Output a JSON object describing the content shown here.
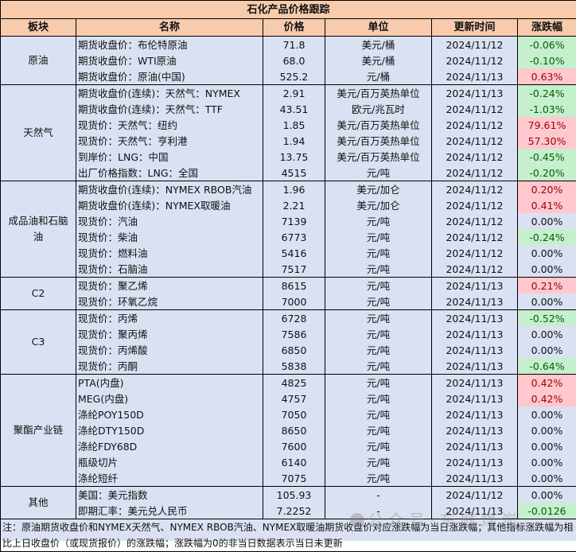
{
  "title": "石化产品价格跟踪",
  "headers": {
    "category": "板块",
    "name": "名称",
    "price": "价格",
    "unit": "单位",
    "date": "更新时间",
    "change": "涨跌幅"
  },
  "colors": {
    "header_bg": "#f8cbad",
    "body_bg": "#dae1f2",
    "up_bg": "#ffc7ce",
    "up_text": "#9c0006",
    "down_bg": "#c6efce",
    "down_text": "#006100"
  },
  "groups": [
    {
      "category": "原油",
      "rows": [
        {
          "name": "期货收盘价：布伦特原油",
          "price": "71.8",
          "unit": "美元/桶",
          "date": "2024/11/12",
          "change": "-0.06%",
          "trend": "down"
        },
        {
          "name": "期货收盘价：WTI原油",
          "price": "68.0",
          "unit": "美元/桶",
          "date": "2024/11/12",
          "change": "-0.10%",
          "trend": "down"
        },
        {
          "name": "期货收盘价：原油(中国)",
          "price": "525.2",
          "unit": "元/桶",
          "date": "2024/11/13",
          "change": "0.63%",
          "trend": "up"
        }
      ]
    },
    {
      "category": "天然气",
      "rows": [
        {
          "name": "期货收盘价(连续)：天然气：NYMEX",
          "price": "2.91",
          "unit": "美元/百万英热单位",
          "date": "2024/11/13",
          "change": "-0.24%",
          "trend": "down"
        },
        {
          "name": "期货收盘价(连续)：天然气：TTF",
          "price": "43.51",
          "unit": "欧元/兆瓦时",
          "date": "2024/11/12",
          "change": "-1.03%",
          "trend": "down"
        },
        {
          "name": "现货价：天然气：纽约",
          "price": "1.85",
          "unit": "美元/百万英热单位",
          "date": "2024/11/12",
          "change": "79.61%",
          "trend": "up"
        },
        {
          "name": "现货价：天然气：亨利港",
          "price": "1.94",
          "unit": "美元/百万英热单位",
          "date": "2024/11/12",
          "change": "57.30%",
          "trend": "up"
        },
        {
          "name": "到岸价：LNG：中国",
          "price": "13.75",
          "unit": "美元/百万英热单位",
          "date": "2024/11/12",
          "change": "-0.45%",
          "trend": "down"
        },
        {
          "name": "出厂价格指数：LNG：全国",
          "price": "4515",
          "unit": "元/吨",
          "date": "2024/11/12",
          "change": "-0.20%",
          "trend": "down"
        }
      ]
    },
    {
      "category": "成品油和石脑油",
      "rows": [
        {
          "name": "期货收盘价(连续)：NYMEX RBOB汽油",
          "price": "1.96",
          "unit": "美元/加仑",
          "date": "2024/11/12",
          "change": "0.20%",
          "trend": "up"
        },
        {
          "name": "期货收盘价(连续)：NYMEX取暖油",
          "price": "2.21",
          "unit": "美元/加仑",
          "date": "2024/11/12",
          "change": "0.41%",
          "trend": "up"
        },
        {
          "name": "现货价：汽油",
          "price": "7139",
          "unit": "元/吨",
          "date": "2024/11/12",
          "change": "0.00%",
          "trend": "flat"
        },
        {
          "name": "现货价：柴油",
          "price": "6773",
          "unit": "元/吨",
          "date": "2024/11/12",
          "change": "-0.24%",
          "trend": "down"
        },
        {
          "name": "现货价：燃料油",
          "price": "5416",
          "unit": "元/吨",
          "date": "2024/11/12",
          "change": "0.00%",
          "trend": "flat"
        },
        {
          "name": "现货价：石脑油",
          "price": "7517",
          "unit": "元/吨",
          "date": "2024/11/12",
          "change": "0.00%",
          "trend": "flat"
        }
      ]
    },
    {
      "category": "C2",
      "rows": [
        {
          "name": "现货价：聚乙烯",
          "price": "8615",
          "unit": "元/吨",
          "date": "2024/11/13",
          "change": "0.21%",
          "trend": "up"
        },
        {
          "name": "现货价：环氧乙烷",
          "price": "7000",
          "unit": "元/吨",
          "date": "2024/11/13",
          "change": "0.00%",
          "trend": "flat"
        }
      ]
    },
    {
      "category": "C3",
      "rows": [
        {
          "name": "现货价：丙烯",
          "price": "6728",
          "unit": "元/吨",
          "date": "2024/11/13",
          "change": "-0.52%",
          "trend": "down"
        },
        {
          "name": "现货价：聚丙烯",
          "price": "7586",
          "unit": "元/吨",
          "date": "2024/11/13",
          "change": "0.00%",
          "trend": "flat"
        },
        {
          "name": "现货价：丙烯酸",
          "price": "6850",
          "unit": "元/吨",
          "date": "2024/11/13",
          "change": "0.00%",
          "trend": "flat"
        },
        {
          "name": "现货价：丙酮",
          "price": "5838",
          "unit": "元/吨",
          "date": "2024/11/13",
          "change": "-0.64%",
          "trend": "down"
        }
      ]
    },
    {
      "category": "聚酯产业链",
      "rows": [
        {
          "name": "PTA(内盘)",
          "price": "4825",
          "unit": "元/吨",
          "date": "2024/11/13",
          "change": "0.42%",
          "trend": "up"
        },
        {
          "name": "MEG(内盘)",
          "price": "4757",
          "unit": "元/吨",
          "date": "2024/11/13",
          "change": "0.42%",
          "trend": "up"
        },
        {
          "name": "涤纶POY150D",
          "price": "7050",
          "unit": "元/吨",
          "date": "2024/11/13",
          "change": "0.00%",
          "trend": "flat"
        },
        {
          "name": "涤纶DTY150D",
          "price": "8650",
          "unit": "元/吨",
          "date": "2024/11/13",
          "change": "0.00%",
          "trend": "flat"
        },
        {
          "name": "涤纶FDY68D",
          "price": "7600",
          "unit": "元/吨",
          "date": "2024/11/13",
          "change": "0.00%",
          "trend": "flat"
        },
        {
          "name": "瓶级切片",
          "price": "6140",
          "unit": "元/吨",
          "date": "2024/11/13",
          "change": "0.00%",
          "trend": "flat"
        },
        {
          "name": "涤纶短纤",
          "price": "7075",
          "unit": "元/吨",
          "date": "2024/11/13",
          "change": "0.00%",
          "trend": "flat"
        }
      ]
    },
    {
      "category": "其他",
      "rows": [
        {
          "name": "美国：美元指数",
          "price": "105.93",
          "unit": "-",
          "date": "2024/11/12",
          "change": "0.00%",
          "trend": "flat"
        },
        {
          "name": "即期汇率：美元兑人民币",
          "price": "7.2252",
          "unit": "-",
          "date": "2024/11/13",
          "change": "-0.0126",
          "trend": "down"
        }
      ]
    }
  ],
  "note": "注：原油期货收盘价和NYMEX天然气、NYMEX RBOB汽油、NYMEX取暖油期货收盘价对应涨跌幅为当日涨跌幅；其他指标涨跌幅为相比上日收盘价（或现货报价）的涨跌幅；涨跌幅为0的非当日数据表示当日未更新",
  "watermark": "公众号·东庭煤炭"
}
